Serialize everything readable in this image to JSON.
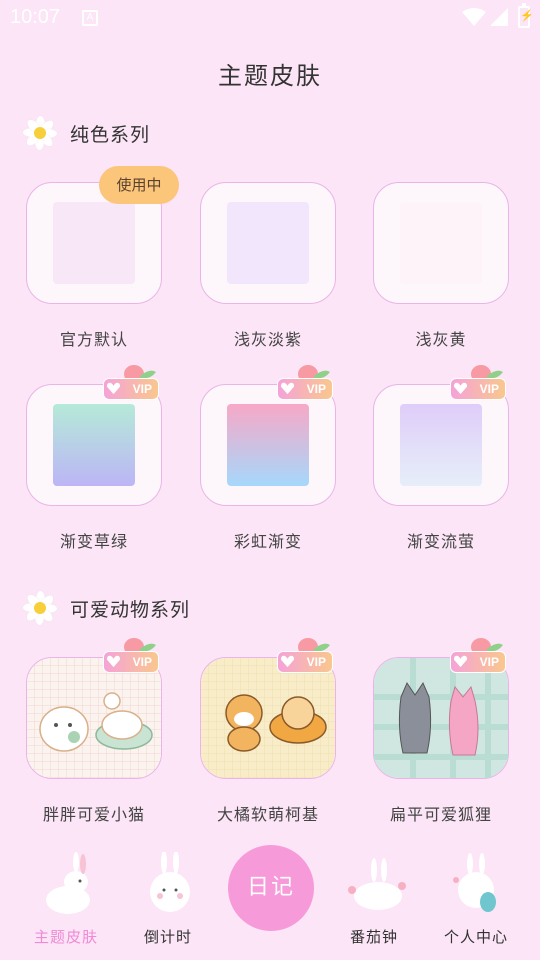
{
  "status_bar": {
    "time": "10:07",
    "notification_glyph": "A"
  },
  "page_title": "主题皮肤",
  "sections": [
    {
      "title": "纯色系列",
      "items": [
        {
          "label": "官方默认",
          "in_use": true,
          "badge": "使用中",
          "vip": false,
          "swatch": "#f8e7f6"
        },
        {
          "label": "浅灰淡紫",
          "in_use": false,
          "vip": false,
          "swatch": "#f1e6fb"
        },
        {
          "label": "浅灰黄",
          "in_use": false,
          "vip": false,
          "swatch": "#fdf3f9"
        },
        {
          "label": "渐变草绿",
          "vip": true,
          "swatch_from": "#b5ead8",
          "swatch_to": "#bcb5f6"
        },
        {
          "label": "彩虹渐变",
          "vip": true,
          "swatch_from": "#f8a8c7",
          "swatch_to": "#a6d8fb"
        },
        {
          "label": "渐变流萤",
          "vip": true,
          "swatch_from": "#dfcdf9",
          "swatch_to": "#e6eef9"
        }
      ]
    },
    {
      "title": "可爱动物系列",
      "items": [
        {
          "label": "胖胖可爱小猫",
          "vip": true,
          "art": "cats"
        },
        {
          "label": "大橘软萌柯基",
          "vip": true,
          "art": "shibas"
        },
        {
          "label": "扁平可爱狐狸",
          "vip": true,
          "art": "foxes"
        }
      ]
    }
  ],
  "vip_text": "VIP",
  "bottom_nav": {
    "items": [
      {
        "label": "主题皮肤",
        "active": true
      },
      {
        "label": "倒计时",
        "active": false
      },
      {
        "label": "番茄钟",
        "active": false
      },
      {
        "label": "个人中心",
        "active": false
      }
    ],
    "center_button": "日记"
  },
  "colors": {
    "accent": "#f08ad6",
    "background": "#fbe5f6",
    "badge": "#fbc57a"
  }
}
